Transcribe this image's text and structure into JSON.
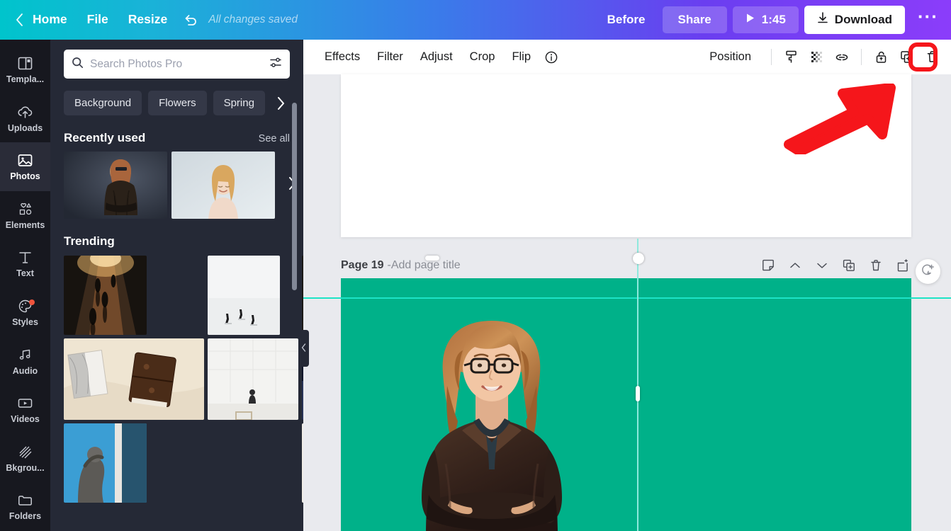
{
  "topbar": {
    "back_icon": "chevron-left-icon",
    "home_label": "Home",
    "file_label": "File",
    "resize_label": "Resize",
    "undo_icon": "undo-icon",
    "save_status": "All changes saved",
    "before_label": "Before",
    "share_label": "Share",
    "play_icon": "play-icon",
    "play_time": "1:45",
    "download_icon": "download-icon",
    "download_label": "Download",
    "more_label": "···",
    "gradient_start": "#00c4cc",
    "gradient_end": "#8b3dfa"
  },
  "rail": {
    "items": [
      {
        "label": "Templa...",
        "icon": "templates-icon",
        "active": false,
        "badge": false
      },
      {
        "label": "Uploads",
        "icon": "cloud-upload-icon",
        "active": false,
        "badge": false
      },
      {
        "label": "Photos",
        "icon": "photo-icon",
        "active": true,
        "badge": false
      },
      {
        "label": "Elements",
        "icon": "shapes-icon",
        "active": false,
        "badge": false
      },
      {
        "label": "Text",
        "icon": "text-icon",
        "active": false,
        "badge": false
      },
      {
        "label": "Styles",
        "icon": "palette-icon",
        "active": false,
        "badge": true
      },
      {
        "label": "Audio",
        "icon": "music-note-icon",
        "active": false,
        "badge": false
      },
      {
        "label": "Videos",
        "icon": "video-icon",
        "active": false,
        "badge": false
      },
      {
        "label": "Bkgrou...",
        "icon": "background-hatch-icon",
        "active": false,
        "badge": false
      },
      {
        "label": "Folders",
        "icon": "folder-icon",
        "active": false,
        "badge": false
      }
    ],
    "badge_color": "#f0543c"
  },
  "panel": {
    "search": {
      "icon": "search-icon",
      "placeholder": "Search Photos Pro",
      "value": "",
      "filter_icon": "sliders-icon"
    },
    "chips": [
      "Background",
      "Flowers",
      "Spring"
    ],
    "chips_next_icon": "chevron-right-icon",
    "recent": {
      "title": "Recently used",
      "see_all": "See all",
      "next_icon": "chevron-right-icon",
      "thumbs": [
        {
          "name": "woman-in-leather-jacket-dark-background"
        },
        {
          "name": "blonde-woman-light-background"
        }
      ]
    },
    "trending": {
      "title": "Trending",
      "thumbs": [
        {
          "name": "people-walking-warm-street-night"
        },
        {
          "name": "figures-on-snow-white-minimal"
        },
        {
          "name": "dark-food-photography-plate"
        },
        {
          "name": "leather-journal-on-cream-cloth"
        },
        {
          "name": "city-skyline-at-dusk"
        },
        {
          "name": "statue-on-blue-background"
        },
        {
          "name": "white-wall-with-small-figure"
        },
        {
          "name": "overhead-table-with-food-bowls"
        }
      ]
    },
    "collapse_icon": "chevron-left-icon"
  },
  "canvas_toolbar": {
    "items": [
      "Effects",
      "Filter",
      "Adjust",
      "Crop",
      "Flip"
    ],
    "info_icon": "info-icon",
    "position_label": "Position",
    "icons": [
      {
        "name": "copy-style-icon",
        "highlighted": false
      },
      {
        "name": "transparency-icon",
        "highlighted": false
      },
      {
        "name": "link-icon",
        "highlighted": false
      },
      {
        "name": "unlock-icon",
        "highlighted": false
      },
      {
        "name": "duplicate-icon",
        "highlighted": true
      },
      {
        "name": "trash-icon",
        "highlighted": false
      }
    ],
    "highlight_color": "#f5161b"
  },
  "page": {
    "title": "Page 19",
    "separator": " - ",
    "subtitle": "Add page title",
    "icons": [
      "notes-icon",
      "chevron-up-icon",
      "chevron-down-icon",
      "duplicate-page-icon",
      "delete-page-icon",
      "add-page-icon"
    ],
    "background_color": "#00b189",
    "selected_element": "woman-portrait-cutout"
  },
  "annotations": {
    "arrow": {
      "name": "red-pointer-arrow",
      "color": "#f5161b",
      "direction": "up-right"
    },
    "ring": {
      "name": "red-highlight-ring",
      "target": "duplicate-icon",
      "color": "#f5161b"
    }
  },
  "comment_button": {
    "icon": "add-comment-icon"
  }
}
